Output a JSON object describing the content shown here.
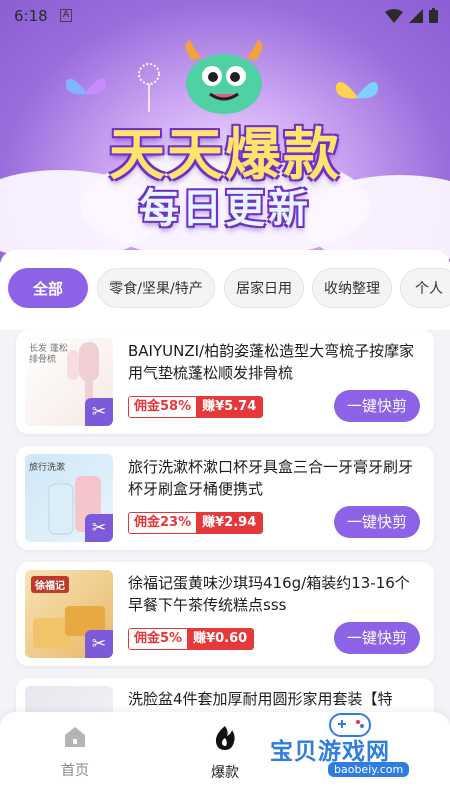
{
  "status_bar": {
    "time": "6:18",
    "a_badge": "A"
  },
  "banner": {
    "title_line1": "天天爆款",
    "title_line2": "每日更新"
  },
  "tabs": [
    {
      "label": "全部",
      "active": true
    },
    {
      "label": "零食/坚果/特产",
      "active": false
    },
    {
      "label": "居家日用",
      "active": false
    },
    {
      "label": "收纳整理",
      "active": false
    },
    {
      "label": "个人",
      "active": false
    }
  ],
  "products": [
    {
      "title": "BAIYUNZI/柏韵姿蓬松造型大弯梳子按摩家用气垫梳蓬松顺发排骨梳",
      "commission": "佣金58%",
      "earn": "赚¥5.74",
      "button": "一键快剪",
      "thumb_text": "长发 蓬松 排骨梳"
    },
    {
      "title": "旅行洗漱杯漱口杯牙具盒三合一牙膏牙刷牙杯牙刷盒牙桶便携式",
      "commission": "佣金23%",
      "earn": "赚¥2.94",
      "button": "一键快剪",
      "thumb_text": "旅行洗漱"
    },
    {
      "title": "徐福记蛋黄味沙琪玛416g/箱装约13-16个早餐下午茶传统糕点sss",
      "commission": "佣金5%",
      "earn": "赚¥0.60",
      "button": "一键快剪",
      "thumb_text": "徐福记"
    },
    {
      "title": "洗脸盆4件套加厚耐用圆形家用套装【特",
      "commission": "",
      "earn": "",
      "button": "",
      "thumb_text": ""
    }
  ],
  "bottom_nav": [
    {
      "label": "首页",
      "icon": "home-icon",
      "active": false
    },
    {
      "label": "爆款",
      "icon": "fire-icon",
      "active": true
    }
  ],
  "watermark": {
    "title": "宝贝游戏网",
    "url": "baobeiy.com"
  },
  "colors": {
    "accent": "#8c63e6",
    "price_red": "#e5383b",
    "watermark_blue": "#2f7de1"
  }
}
